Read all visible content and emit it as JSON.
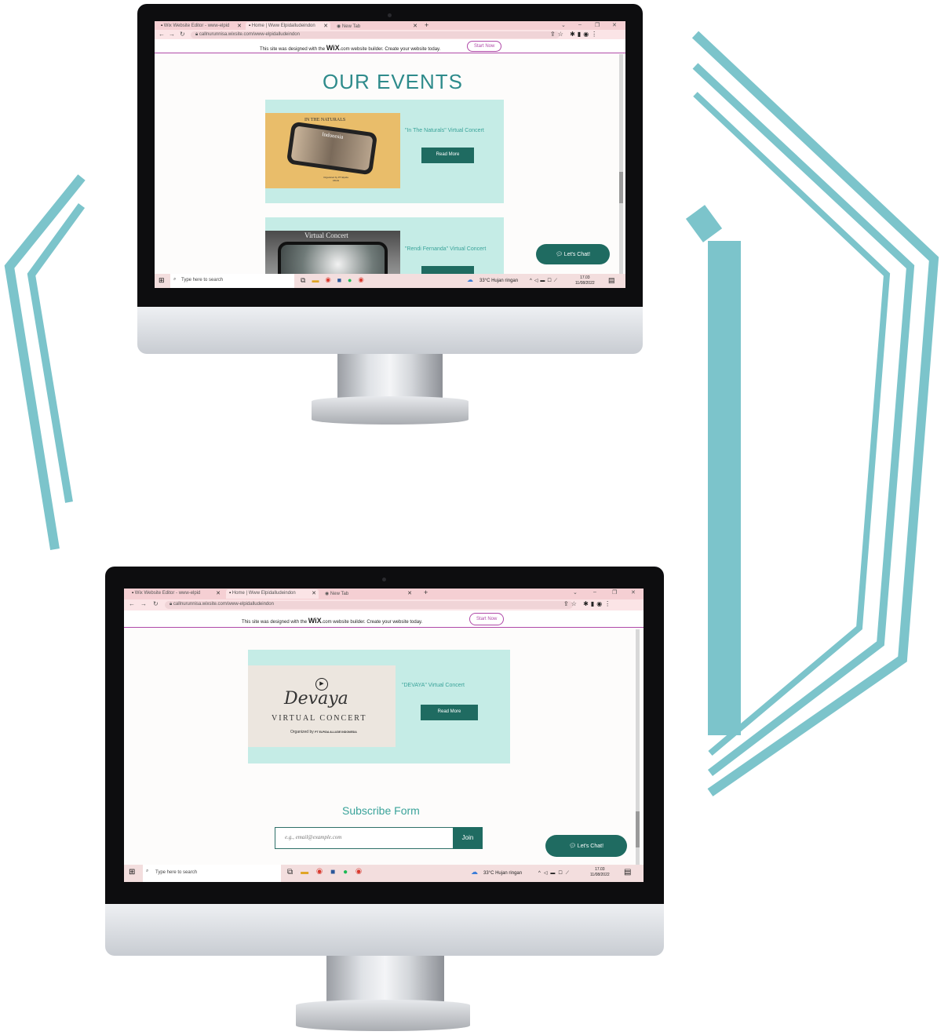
{
  "colors": {
    "accent_teal": "#7cc4cb",
    "card_bg": "#c5ece6",
    "button_green": "#1f6b61",
    "wix_purple": "#b04aa8",
    "tab_pink": "#f5cfd3"
  },
  "browser": {
    "tabs": [
      {
        "label": "Wix Website Editor - www-elpid",
        "icon": "wix-icon"
      },
      {
        "label": "Home | Www Elpidalludeindon",
        "icon": "wix-icon"
      },
      {
        "label": "New Tab",
        "icon": "chrome-icon"
      }
    ],
    "new_tab_symbol": "+",
    "url": "callnurunnisa.wixsite.com/www-elpidalludeindon"
  },
  "wix_banner": {
    "text_before": "This site was designed with the",
    "brand": "WiX",
    "text_after": ".com website builder. Create your website today.",
    "button": "Start Now"
  },
  "screen1": {
    "heading": "OUR EVENTS",
    "events": [
      {
        "title": "\"In The Naturals\" Virtual Concert",
        "button": "Read More",
        "poster_title": "IN THE NATURALS",
        "poster_sub": "Indonesia",
        "poster_org": "Organized by PT Elpida Alluds"
      },
      {
        "title": "\"Rendi Fernanda\" Virtual Concert",
        "button": "Read More",
        "poster_title": "Virtual Concert"
      }
    ],
    "chat": "Let's Chat!"
  },
  "screen2": {
    "event": {
      "title": "\"DEVAYA\" Virtual Concert",
      "button": "Read More",
      "poster_script": "Devaya",
      "poster_sub": "VIRTUAL CONCERT",
      "poster_org_label": "Organized by",
      "poster_org": "PT ELPIDA ALLUDE INDONESIA"
    },
    "subscribe_title": "Subscribe Form",
    "email_placeholder": "e.g., email@example.com",
    "join": "Join",
    "chat": "Let's Chat!"
  },
  "taskbar": {
    "search_placeholder": "Type here to search",
    "weather": "33°C  Hujan ringan",
    "time": "17.03",
    "date": "11/08/2022"
  }
}
